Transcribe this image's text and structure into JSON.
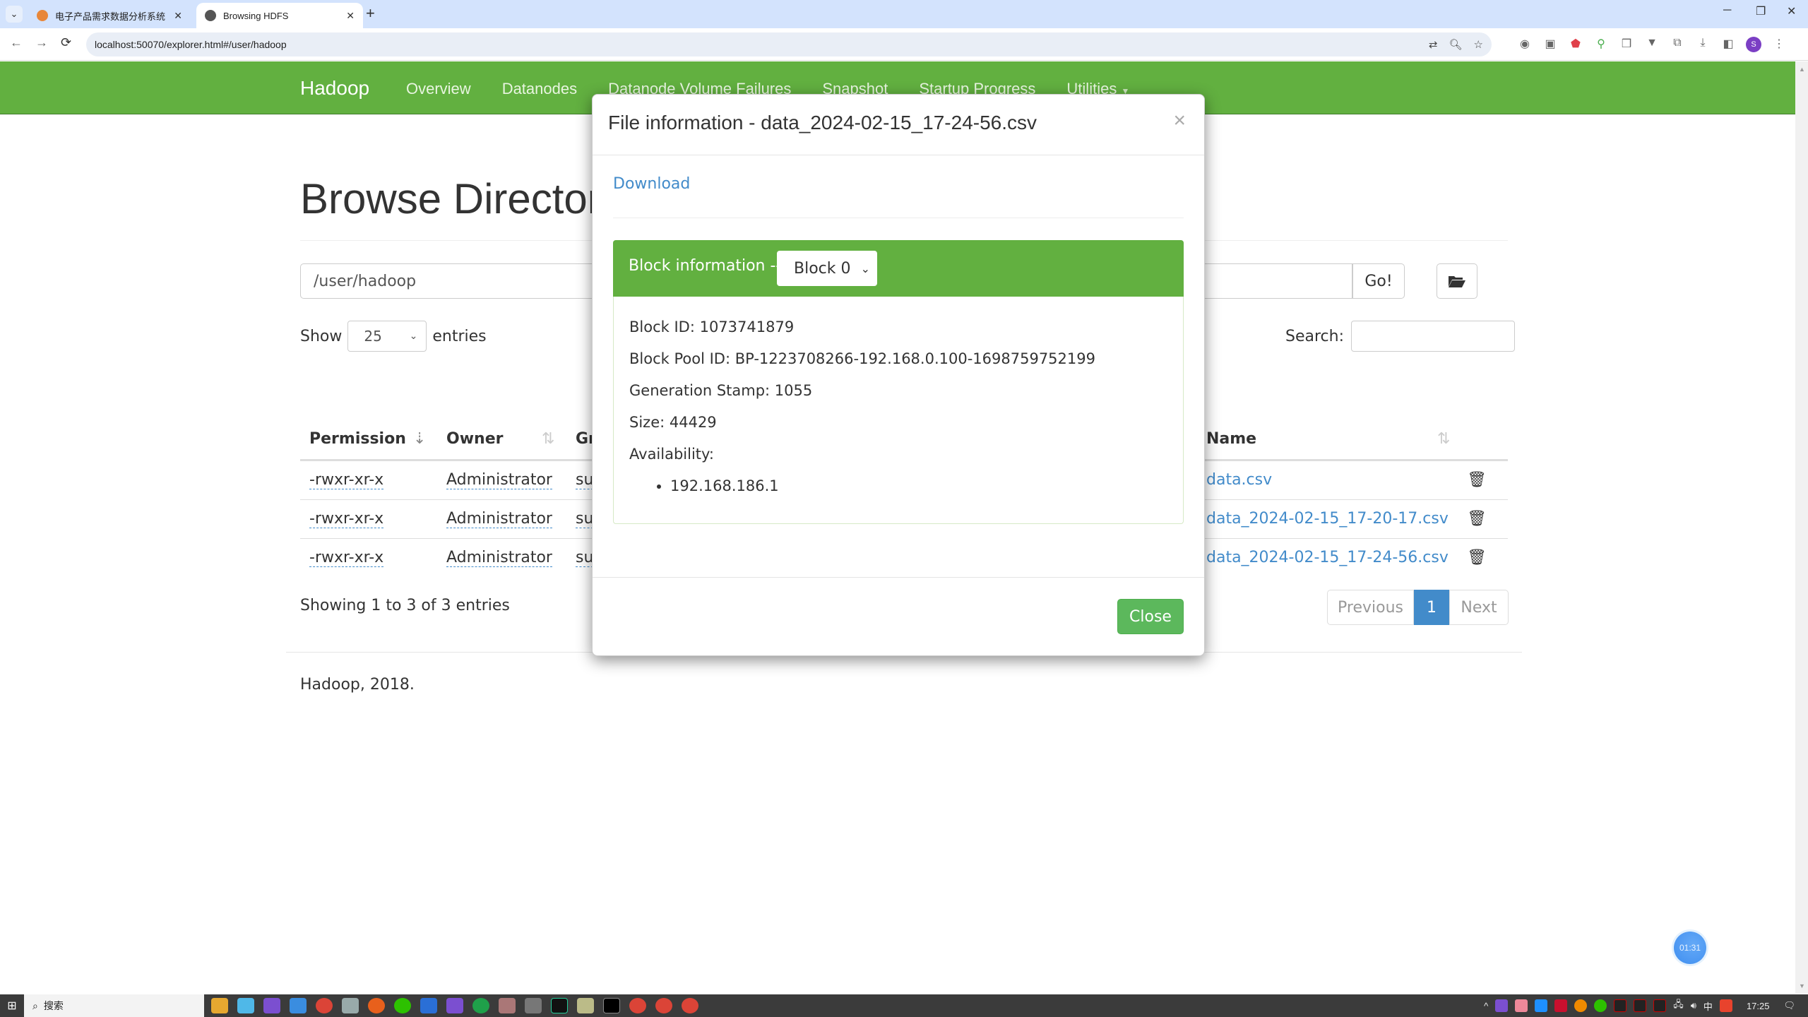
{
  "browser": {
    "tabs": [
      {
        "title": "电子产品需求数据分析系统 - 主",
        "active": false
      },
      {
        "title": "Browsing HDFS",
        "active": true
      }
    ],
    "url": "localhost:50070/explorer.html#/user/hadoop",
    "new_tab": "+",
    "profile_initial": "S"
  },
  "navbar": {
    "brand": "Hadoop",
    "links": [
      "Overview",
      "Datanodes",
      "Datanode Volume Failures",
      "Snapshot",
      "Startup Progress",
      "Utilities"
    ]
  },
  "page": {
    "title": "Browse Directory",
    "path_value": "/user/hadoop",
    "go_label": "Go!",
    "show_label": "Show",
    "entries_label": "entries",
    "page_size": "25",
    "search_label": "Search:",
    "search_value": "",
    "columns": [
      "Permission",
      "Owner",
      "Gr",
      "Name"
    ],
    "rows": [
      {
        "permission": "-rwxr-xr-x",
        "owner": "Administrator",
        "group": "su",
        "name": "data.csv"
      },
      {
        "permission": "-rwxr-xr-x",
        "owner": "Administrator",
        "group": "su",
        "name": "data_2024-02-15_17-20-17.csv"
      },
      {
        "permission": "-rwxr-xr-x",
        "owner": "Administrator",
        "group": "su",
        "name": "data_2024-02-15_17-24-56.csv"
      }
    ],
    "info": "Showing 1 to 3 of 3 entries",
    "pager": {
      "previous": "Previous",
      "current": "1",
      "next": "Next"
    },
    "footer": "Hadoop, 2018."
  },
  "modal": {
    "title": "File information - data_2024-02-15_17-24-56.csv",
    "close_x": "×",
    "download": "Download",
    "block_header": "Block information --",
    "block_selected": "Block 0",
    "block_id": "Block ID: 1073741879",
    "block_pool_id": "Block Pool ID: BP-1223708266-192.168.0.100-1698759752199",
    "generation_stamp": "Generation Stamp: 1055",
    "size": "Size: 44429",
    "availability_label": "Availability:",
    "availability": [
      "192.168.186.1"
    ],
    "close_button": "Close"
  },
  "timer": "01:31",
  "taskbar": {
    "search_placeholder": "搜索",
    "ime": "中",
    "clock": "17:25"
  },
  "colors": {
    "hadoop_green": "#62b040",
    "link_blue": "#428bca",
    "close_green": "#5cb85c"
  }
}
